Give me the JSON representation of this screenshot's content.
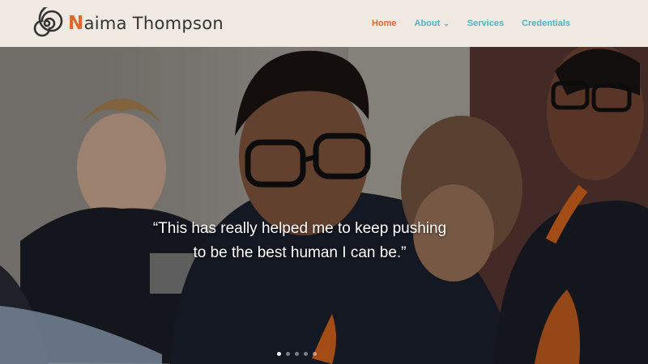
{
  "brand": {
    "initial": "N",
    "rest": "aima Thompson",
    "logo_icon": "spiral-logo-icon"
  },
  "nav": {
    "items": [
      {
        "label": "Home",
        "active": true
      },
      {
        "label": "About",
        "has_dropdown": true
      },
      {
        "label": "Services"
      },
      {
        "label": "Credentials"
      }
    ]
  },
  "hero": {
    "quote_line1": "“This has really helped me to keep pushing",
    "quote_line2": "to be the best human I can be.”",
    "slides": 5,
    "active_slide": 1
  },
  "colors": {
    "accent_orange": "#e2672a",
    "nav_teal": "#4bb3c9",
    "header_bg": "#efe9e1"
  }
}
